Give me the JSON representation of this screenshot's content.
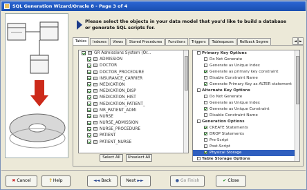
{
  "window": {
    "title": "SQL Generation Wizard/Oracle 8 - Page 3 of 4"
  },
  "instructions": "Please select the objects in your data model that you'd like to build a database or generate SQL scripts for.",
  "tabs": [
    "Tables",
    "Indexes",
    "Views",
    "Stored Procedures",
    "Functions",
    "Triggers",
    "Tablespaces",
    "Rollback Segme"
  ],
  "tab_nav": {
    "prev": "◄",
    "next": "►"
  },
  "object_list": {
    "root": "GR Admissions System (Or...",
    "items": [
      "ADMISSION",
      "DOCTOR",
      "DOCTOR_PROCEDURE",
      "INSURANCE_CARRIER",
      "MEDICATION",
      "MEDICATION_DISP",
      "MEDICATION_HIST",
      "MEDICATION_PATIENT_",
      "MR_PATIENT_ADMI",
      "NURSE",
      "NURSE_ADMISSION",
      "NURSE_PROCEDURE",
      "PATIENT",
      "PATIENT_NURSE"
    ]
  },
  "list_buttons": {
    "select_all": "Select All",
    "unselect_all": "Unselect All"
  },
  "options": [
    {
      "type": "hdr",
      "label": "Primary Key Options"
    },
    {
      "type": "item",
      "label": "Do Not Generate",
      "checked": false
    },
    {
      "type": "item",
      "label": "Generate as Unique Index",
      "checked": false
    },
    {
      "type": "item",
      "label": "Generate as primary key constraint",
      "checked": true
    },
    {
      "type": "item",
      "label": "Disable Constraint Name",
      "checked": false
    },
    {
      "type": "item",
      "label": "Generate Primary Key as ALTER statement",
      "checked": true
    },
    {
      "type": "hdr",
      "label": "Alternate Key Options"
    },
    {
      "type": "item",
      "label": "Do Not Generate",
      "checked": false
    },
    {
      "type": "item",
      "label": "Generate as Unique Index",
      "checked": false
    },
    {
      "type": "item",
      "label": "Generate as Unique Constraint",
      "checked": true
    },
    {
      "type": "item",
      "label": "Disable Constraint Name",
      "checked": false
    },
    {
      "type": "hdr",
      "label": "Generation Options"
    },
    {
      "type": "item",
      "label": "CREATE Statements",
      "checked": true
    },
    {
      "type": "item",
      "label": "DROP Statements",
      "checked": true
    },
    {
      "type": "item",
      "label": "Pre-Script",
      "checked": false
    },
    {
      "type": "item",
      "label": "Post-Script",
      "checked": false
    },
    {
      "type": "item",
      "label": "Physical Storage",
      "checked": true,
      "selected": true
    },
    {
      "type": "hdr",
      "label": "Table Storage Options"
    }
  ],
  "buttons": {
    "cancel": "Cancel",
    "help": "Help",
    "back": "Back",
    "next": "Next",
    "generate": "Go Finish",
    "close": "Close"
  },
  "button_icons": {
    "cancel": "✖",
    "help": "?",
    "back": "◄◄",
    "next": "►►",
    "generate": "●",
    "close": "✔"
  }
}
